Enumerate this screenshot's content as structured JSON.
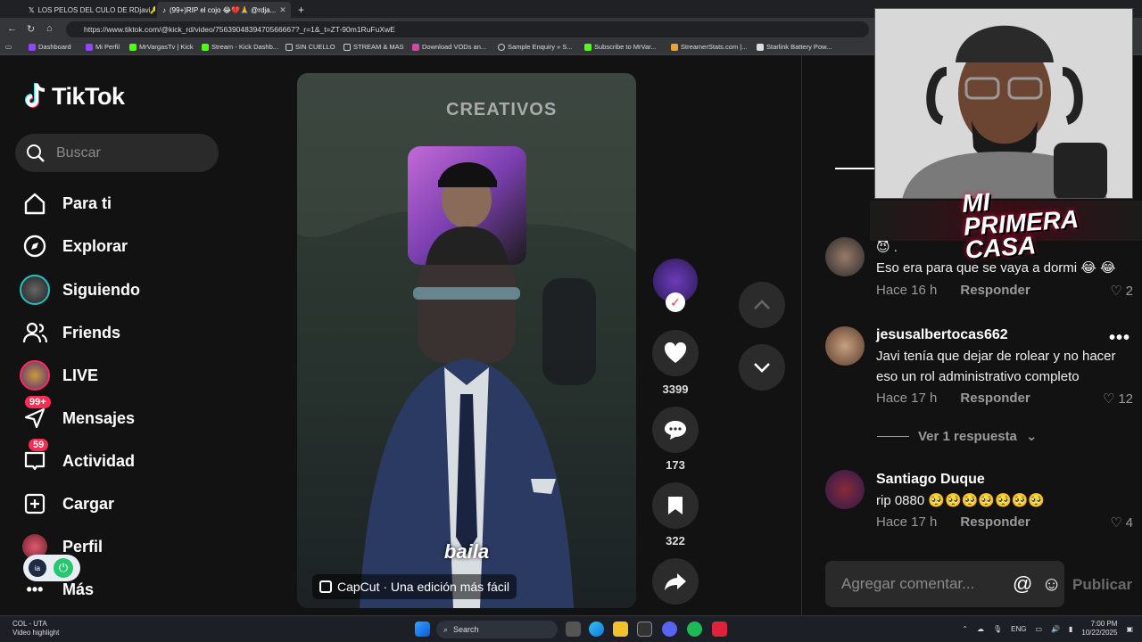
{
  "browser": {
    "tabs": [
      {
        "title": "LOS PELOS DEL CULO DE RDjavi🔑",
        "active": false
      },
      {
        "title": "(99+)RIP el cojo 😂💔🙏 @rdja...",
        "active": true
      }
    ],
    "url": "https://www.tiktok.com/@kick_rd/video/7563904839470566667?_r=1&_t=ZT-90m1RuFuXwE",
    "bookmarks": [
      "Dashboard",
      "Mi Perfil",
      "MrVargasTv | Kick",
      "Stream - Kick Dashb...",
      "SIN CUELLO",
      "STREAM & MAS",
      "Download VODs an...",
      "Sample Enquiry » S...",
      "Subscribe to MrVar...",
      "StreamerStats.com |...",
      "Starlink Battery Pow..."
    ]
  },
  "tiktok": {
    "logo_text": "TikTok",
    "search_placeholder": "Buscar",
    "nav": {
      "for_you": "Para ti",
      "explore": "Explorar",
      "following": "Siguiendo",
      "friends": "Friends",
      "live": "LIVE",
      "messages": "Mensajes",
      "messages_badge": "99+",
      "activity": "Actividad",
      "activity_badge": "59",
      "upload": "Cargar",
      "profile": "Perfil",
      "more": "Más"
    },
    "video": {
      "watermark": "CREATIVOS",
      "subtitle": "baila",
      "capcut": "CapCut · Una edición más fácil"
    },
    "actions": {
      "likes": "3399",
      "comments": "173",
      "saves": "322"
    },
    "comments": [
      {
        "user": "",
        "text": "😈 .\nEso era para que se vaya a dormi 😂 😂",
        "time": "Hace 16 h",
        "reply": "Responder",
        "likes": "2"
      },
      {
        "user": "jesusalbertocas662",
        "text": "Javi tenía que dejar de rolear y no hacer eso un rol administrativo completo",
        "time": "Hace 17 h",
        "reply": "Responder",
        "likes": "12"
      },
      {
        "user": "Santiago Duque",
        "text": "rip 0880 🥺🥺🥺🥺🥺🥺🥺",
        "time": "Hace 17 h",
        "reply": "Responder",
        "likes": "4"
      }
    ],
    "view_replies": "Ver 1 respuesta",
    "comment_placeholder": "Agregar comentar...",
    "publish": "Publicar"
  },
  "overlay": {
    "stream_title": "MI PRIMERA CASA"
  },
  "taskbar": {
    "weather_title": "COL - UTA",
    "weather_sub": "Video highlight",
    "search": "Search",
    "lang": "ENG",
    "time": "7:00 PM",
    "date": "10/22/2025"
  },
  "colors": {
    "accent": "#fe2c55",
    "bg": "#121212",
    "panel": "#2a2a2a"
  }
}
